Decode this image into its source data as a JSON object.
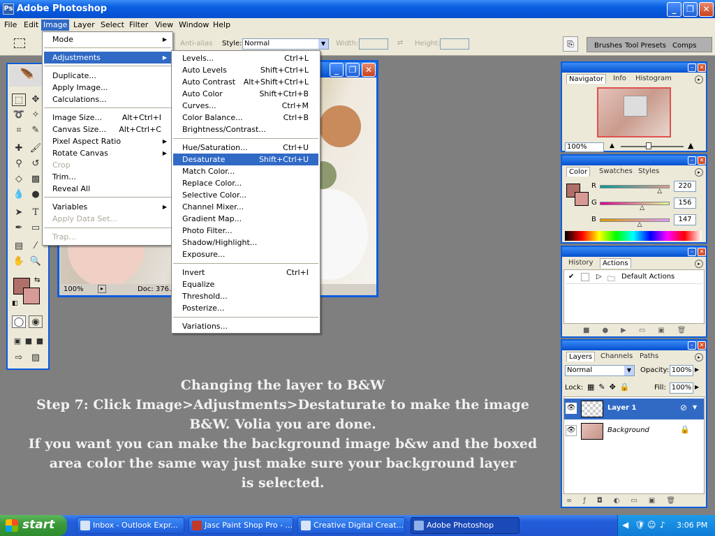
{
  "window": {
    "title": "Adobe Photoshop",
    "min_symbol": "_",
    "max_symbol": "❐",
    "close_symbol": "✕"
  },
  "menubar": [
    "File",
    "Edit",
    "Image",
    "Layer",
    "Select",
    "Filter",
    "View",
    "Window",
    "Help"
  ],
  "options": {
    "anti_alias": "Anti-alias",
    "style_label": "Style:",
    "style_value": "Normal",
    "width_label": "Width:",
    "height_label": "Height:",
    "tabs": [
      "Brushes",
      "Tool Presets",
      "Comps"
    ]
  },
  "image_menu": {
    "items": [
      {
        "label": "Mode",
        "shortcut": "",
        "submenu": true
      },
      {
        "label": "Adjustments",
        "shortcut": "",
        "submenu": true,
        "highlight": true
      },
      {
        "label": "Duplicate...",
        "shortcut": ""
      },
      {
        "label": "Apply Image...",
        "shortcut": ""
      },
      {
        "label": "Calculations...",
        "shortcut": ""
      },
      {
        "label": "Image Size...",
        "shortcut": "Alt+Ctrl+I"
      },
      {
        "label": "Canvas Size...",
        "shortcut": "Alt+Ctrl+C"
      },
      {
        "label": "Pixel Aspect Ratio",
        "shortcut": "",
        "submenu": true
      },
      {
        "label": "Rotate Canvas",
        "shortcut": "",
        "submenu": true
      },
      {
        "label": "Crop",
        "shortcut": "",
        "disabled": true
      },
      {
        "label": "Trim...",
        "shortcut": ""
      },
      {
        "label": "Reveal All",
        "shortcut": ""
      },
      {
        "label": "Variables",
        "shortcut": "",
        "submenu": true
      },
      {
        "label": "Apply Data Set...",
        "shortcut": "",
        "disabled": true
      },
      {
        "label": "Trap...",
        "shortcut": "",
        "disabled": true
      }
    ]
  },
  "adjustments_menu": {
    "items": [
      {
        "label": "Levels...",
        "shortcut": "Ctrl+L"
      },
      {
        "label": "Auto Levels",
        "shortcut": "Shift+Ctrl+L"
      },
      {
        "label": "Auto Contrast",
        "shortcut": "Alt+Shift+Ctrl+L"
      },
      {
        "label": "Auto Color",
        "shortcut": "Shift+Ctrl+B"
      },
      {
        "label": "Curves...",
        "shortcut": "Ctrl+M"
      },
      {
        "label": "Color Balance...",
        "shortcut": "Ctrl+B"
      },
      {
        "label": "Brightness/Contrast...",
        "shortcut": ""
      },
      {
        "label": "Hue/Saturation...",
        "shortcut": "Ctrl+U"
      },
      {
        "label": "Desaturate",
        "shortcut": "Shift+Ctrl+U",
        "highlight": true
      },
      {
        "label": "Match Color...",
        "shortcut": ""
      },
      {
        "label": "Replace Color...",
        "shortcut": ""
      },
      {
        "label": "Selective Color...",
        "shortcut": ""
      },
      {
        "label": "Channel Mixer...",
        "shortcut": ""
      },
      {
        "label": "Gradient Map...",
        "shortcut": ""
      },
      {
        "label": "Photo Filter...",
        "shortcut": ""
      },
      {
        "label": "Shadow/Highlight...",
        "shortcut": ""
      },
      {
        "label": "Exposure...",
        "shortcut": ""
      },
      {
        "label": "Invert",
        "shortcut": "Ctrl+I"
      },
      {
        "label": "Equalize",
        "shortcut": ""
      },
      {
        "label": "Threshold...",
        "shortcut": ""
      },
      {
        "label": "Posterize...",
        "shortcut": ""
      },
      {
        "label": "Variations...",
        "shortcut": ""
      }
    ]
  },
  "document": {
    "zoom": "100%",
    "doc_info": "Doc: 376.8"
  },
  "navigator": {
    "tabs": [
      "Navigator",
      "Info",
      "Histogram"
    ],
    "zoom": "100%"
  },
  "color_panel": {
    "tabs": [
      "Color",
      "Swatches",
      "Styles"
    ],
    "foreground": "#b0706a",
    "channels": [
      {
        "label": "R",
        "value": "220",
        "level": 0.863
      },
      {
        "label": "G",
        "value": "156",
        "level": 0.612
      },
      {
        "label": "B",
        "value": "147",
        "level": 0.576
      }
    ]
  },
  "history_panel": {
    "tabs": [
      "History",
      "Actions"
    ],
    "action_set": "Default Actions"
  },
  "layers_panel": {
    "tabs": [
      "Layers",
      "Channels",
      "Paths"
    ],
    "blend_mode": "Normal",
    "opacity_label": "Opacity:",
    "opacity": "100%",
    "lock_label": "Lock:",
    "fill_label": "Fill:",
    "fill": "100%",
    "layers": [
      {
        "name": "Layer 1",
        "selected": true
      },
      {
        "name": "Background",
        "selected": false
      }
    ]
  },
  "caption": [
    "Changing the layer to B&W",
    "Step 7: Click Image>Adjustments>Destaturate to make the image",
    "B&W. Volia you are done.",
    "If you want you can make the background image b&w and the boxed",
    "area color the same way just make sure your background layer",
    "is selected."
  ],
  "taskbar": {
    "start": "start",
    "tasks": [
      "Inbox - Outlook Expr...",
      "Jasc Paint Shop Pro - ...",
      "Creative Digital Creat...",
      "Adobe Photoshop"
    ],
    "clock": "3:06 PM"
  }
}
